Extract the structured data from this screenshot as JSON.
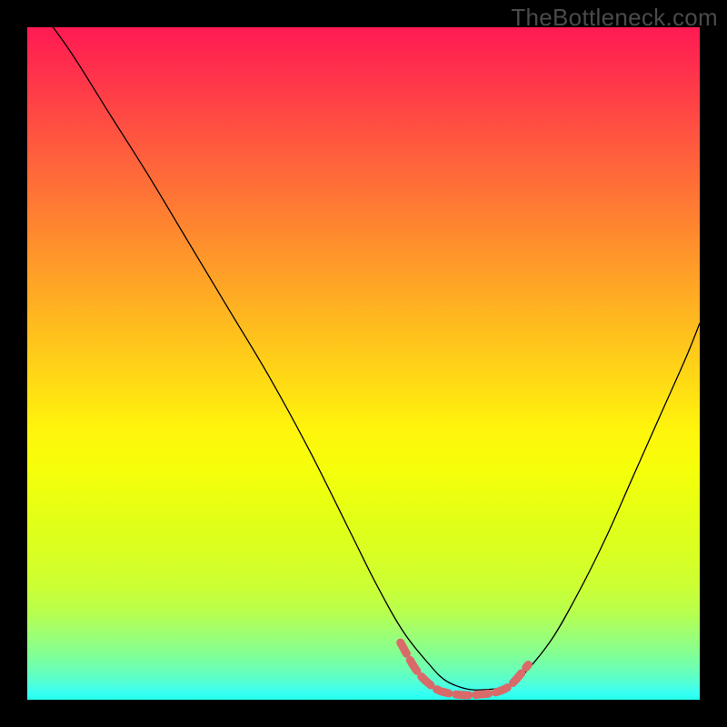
{
  "watermark": "TheBottleneck.com",
  "chart_data": {
    "type": "line",
    "title": "",
    "xlabel": "",
    "ylabel": "",
    "xlim": [
      0,
      100
    ],
    "ylim": [
      0,
      100
    ],
    "series": [
      {
        "name": "curve",
        "stroke": "#000000",
        "stroke_width": 1.3,
        "x": [
          0,
          6,
          12,
          18,
          24,
          30,
          36,
          42,
          48,
          52,
          56,
          60,
          62,
          64,
          66,
          68,
          70,
          72,
          74,
          78,
          82,
          86,
          90,
          94,
          98,
          100
        ],
        "y": [
          105,
          97,
          87.5,
          78,
          68,
          58,
          48,
          37,
          25,
          17,
          10,
          5,
          3,
          2,
          1.5,
          1.5,
          1.7,
          2.4,
          4,
          9,
          16,
          24,
          33,
          42,
          51,
          56
        ]
      },
      {
        "name": "trough-marker",
        "stroke": "#d96a6a",
        "stroke_width": 9,
        "dash": [
          14,
          8
        ],
        "linecap": "round",
        "x": [
          55.5,
          58,
          60.5,
          62.5,
          65,
          67.5,
          70,
          72,
          74.5
        ],
        "y": [
          8.5,
          4.2,
          1.8,
          1.0,
          0.7,
          0.8,
          1.2,
          2.3,
          5.2
        ]
      }
    ],
    "gradient_stops": [
      {
        "pos": 0.0,
        "color": "#ff1a53"
      },
      {
        "pos": 0.5,
        "color": "#ffd018"
      },
      {
        "pos": 0.82,
        "color": "#ccff33"
      },
      {
        "pos": 1.0,
        "color": "#23ffea"
      }
    ]
  }
}
